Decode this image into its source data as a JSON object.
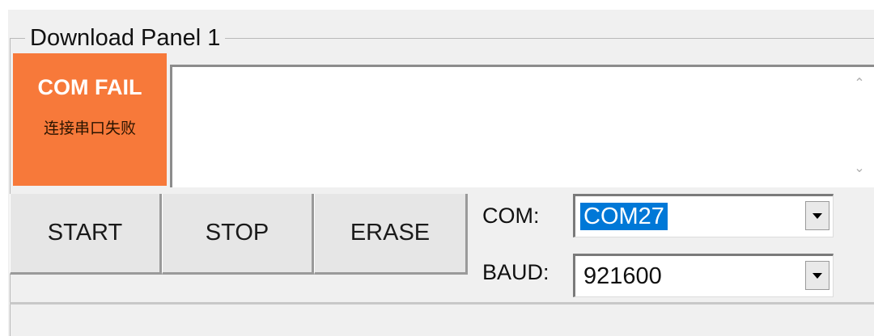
{
  "panel": {
    "title": "Download Panel 1",
    "status": {
      "title": "COM FAIL",
      "subtitle": "连接串口失败",
      "color": "#f7793a"
    },
    "log": {
      "text": ""
    },
    "buttons": {
      "start": "START",
      "stop": "STOP",
      "erase": "ERASE"
    },
    "com": {
      "label": "COM:",
      "value": "COM27"
    },
    "baud": {
      "label": "BAUD:",
      "value": "921600"
    },
    "icons": {
      "scroll_up": "chevron-up-icon",
      "scroll_down": "chevron-down-icon",
      "dropdown": "dropdown-arrow-icon"
    }
  }
}
